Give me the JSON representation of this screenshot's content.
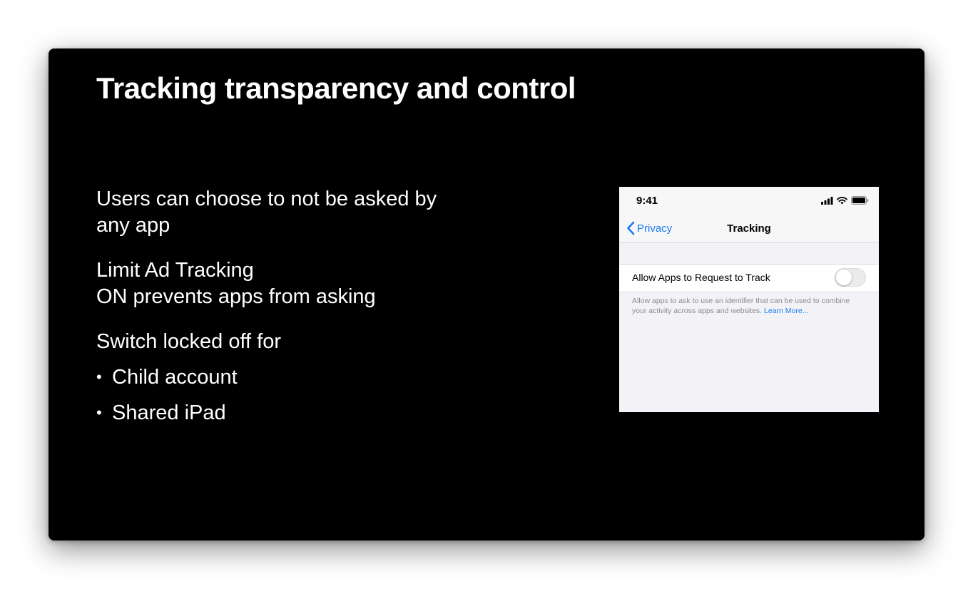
{
  "slide": {
    "title": "Tracking transparency and control",
    "paragraphs": [
      [
        "Users can choose to not be asked by",
        "any app"
      ],
      [
        "Limit Ad Tracking",
        "ON prevents apps from asking"
      ],
      [
        "Switch locked off for"
      ]
    ],
    "bullets": [
      "Child account",
      "Shared iPad"
    ],
    "bullet_glyph": "•"
  },
  "phone": {
    "status_bar": {
      "time": "9:41",
      "icons": [
        "cellular-signal-icon",
        "wifi-icon",
        "battery-icon"
      ]
    },
    "nav": {
      "back_label": "Privacy",
      "title": "Tracking"
    },
    "setting": {
      "label": "Allow Apps to Request to Track",
      "toggle_on": false
    },
    "footer": {
      "text": "Allow apps to ask to use an identifier that can be used to combine your activity across apps and websites.",
      "link": "Learn More..."
    }
  },
  "colors": {
    "slide_background": "#000000",
    "slide_text": "#ffffff",
    "ios_blue": "#1a7cf2",
    "ios_grouped_background": "#f2f2f7"
  }
}
